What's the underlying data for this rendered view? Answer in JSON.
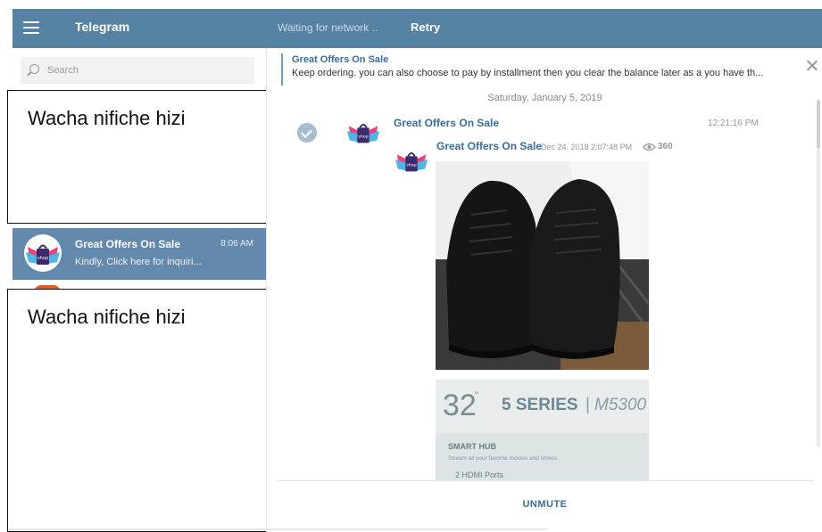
{
  "header": {
    "title": "Telegram",
    "network_status": "Waiting for network ..",
    "retry_label": "Retry"
  },
  "sidebar": {
    "search_placeholder": "Search",
    "redaction_text": "Wacha nifiche hizi",
    "dialog": {
      "name": "Great Offers On Sale",
      "time": "8:06 AM",
      "preview": "Kindly, Click here for inquiri..."
    }
  },
  "chat": {
    "pinned": {
      "title": "Great Offers On Sale",
      "text": "Keep ordering. you can also choose to pay by installment then you clear the balance later as a you have th..."
    },
    "date_separator": "Saturday, January 5, 2019",
    "message": {
      "author": "Great Offers On Sale",
      "time": "12:21:16 PM",
      "forwarded": {
        "author": "Great Offers On Sale",
        "date": "Dec 24, 2018 2:07:48 PM",
        "views": "360"
      },
      "tv_photo": {
        "size": "32",
        "size_unit": "\"",
        "series": "5 SERIES",
        "model": "M5300",
        "feature_title": "SMART HUB",
        "feature_text": "Stream all your favorite movies and shows",
        "ports": "2 HDMI Ports"
      }
    },
    "unmute_label": "UNMUTE"
  },
  "colors": {
    "header_bg": "#5682a3",
    "active_dialog_bg": "#6389ad",
    "link_blue": "#3a6d99"
  }
}
